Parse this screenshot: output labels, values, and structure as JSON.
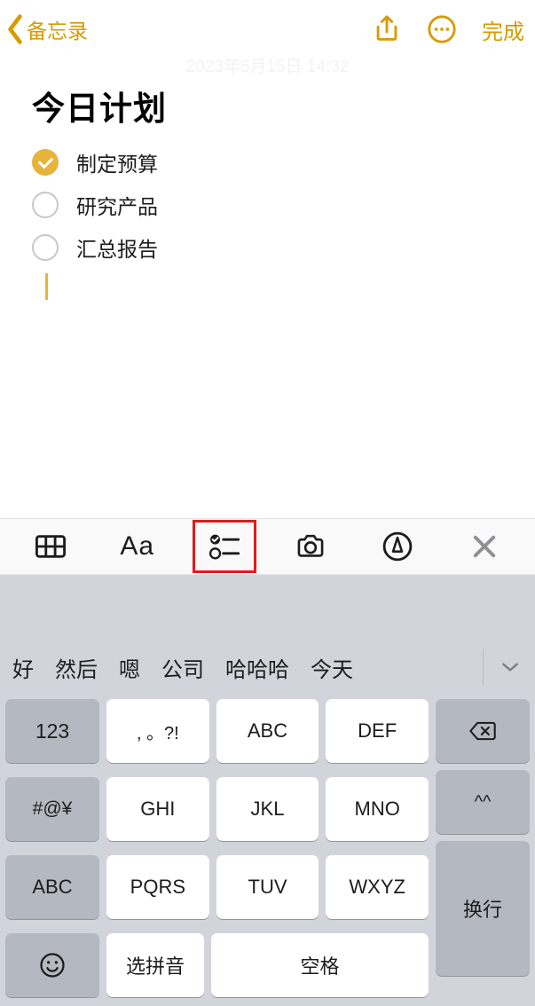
{
  "nav": {
    "back_label": "备忘录",
    "done_label": "完成"
  },
  "note": {
    "timestamp": "2023年5月15日 14:32",
    "title": "今日计划",
    "items": [
      {
        "label": "制定预算",
        "checked": true
      },
      {
        "label": "研究产品",
        "checked": false
      },
      {
        "label": "汇总报告",
        "checked": false
      }
    ]
  },
  "format_toolbar": {
    "aa_label": "Aa"
  },
  "candidates": [
    "好",
    "然后",
    "嗯",
    "公司",
    "哈哈哈",
    "今天"
  ],
  "keyboard": {
    "row1": {
      "fn": "123",
      "keys": [
        ", 。?!",
        "ABC",
        "DEF"
      ],
      "side": "delete"
    },
    "row2": {
      "fn": "#@¥",
      "keys": [
        "GHI",
        "JKL",
        "MNO"
      ],
      "side": "^^"
    },
    "row3": {
      "fn": "ABC",
      "keys": [
        "PQRS",
        "TUV",
        "WXYZ"
      ]
    },
    "row4": {
      "fn": "emoji",
      "pinyin": "选拼音",
      "space": "空格"
    },
    "enter": "换行"
  }
}
